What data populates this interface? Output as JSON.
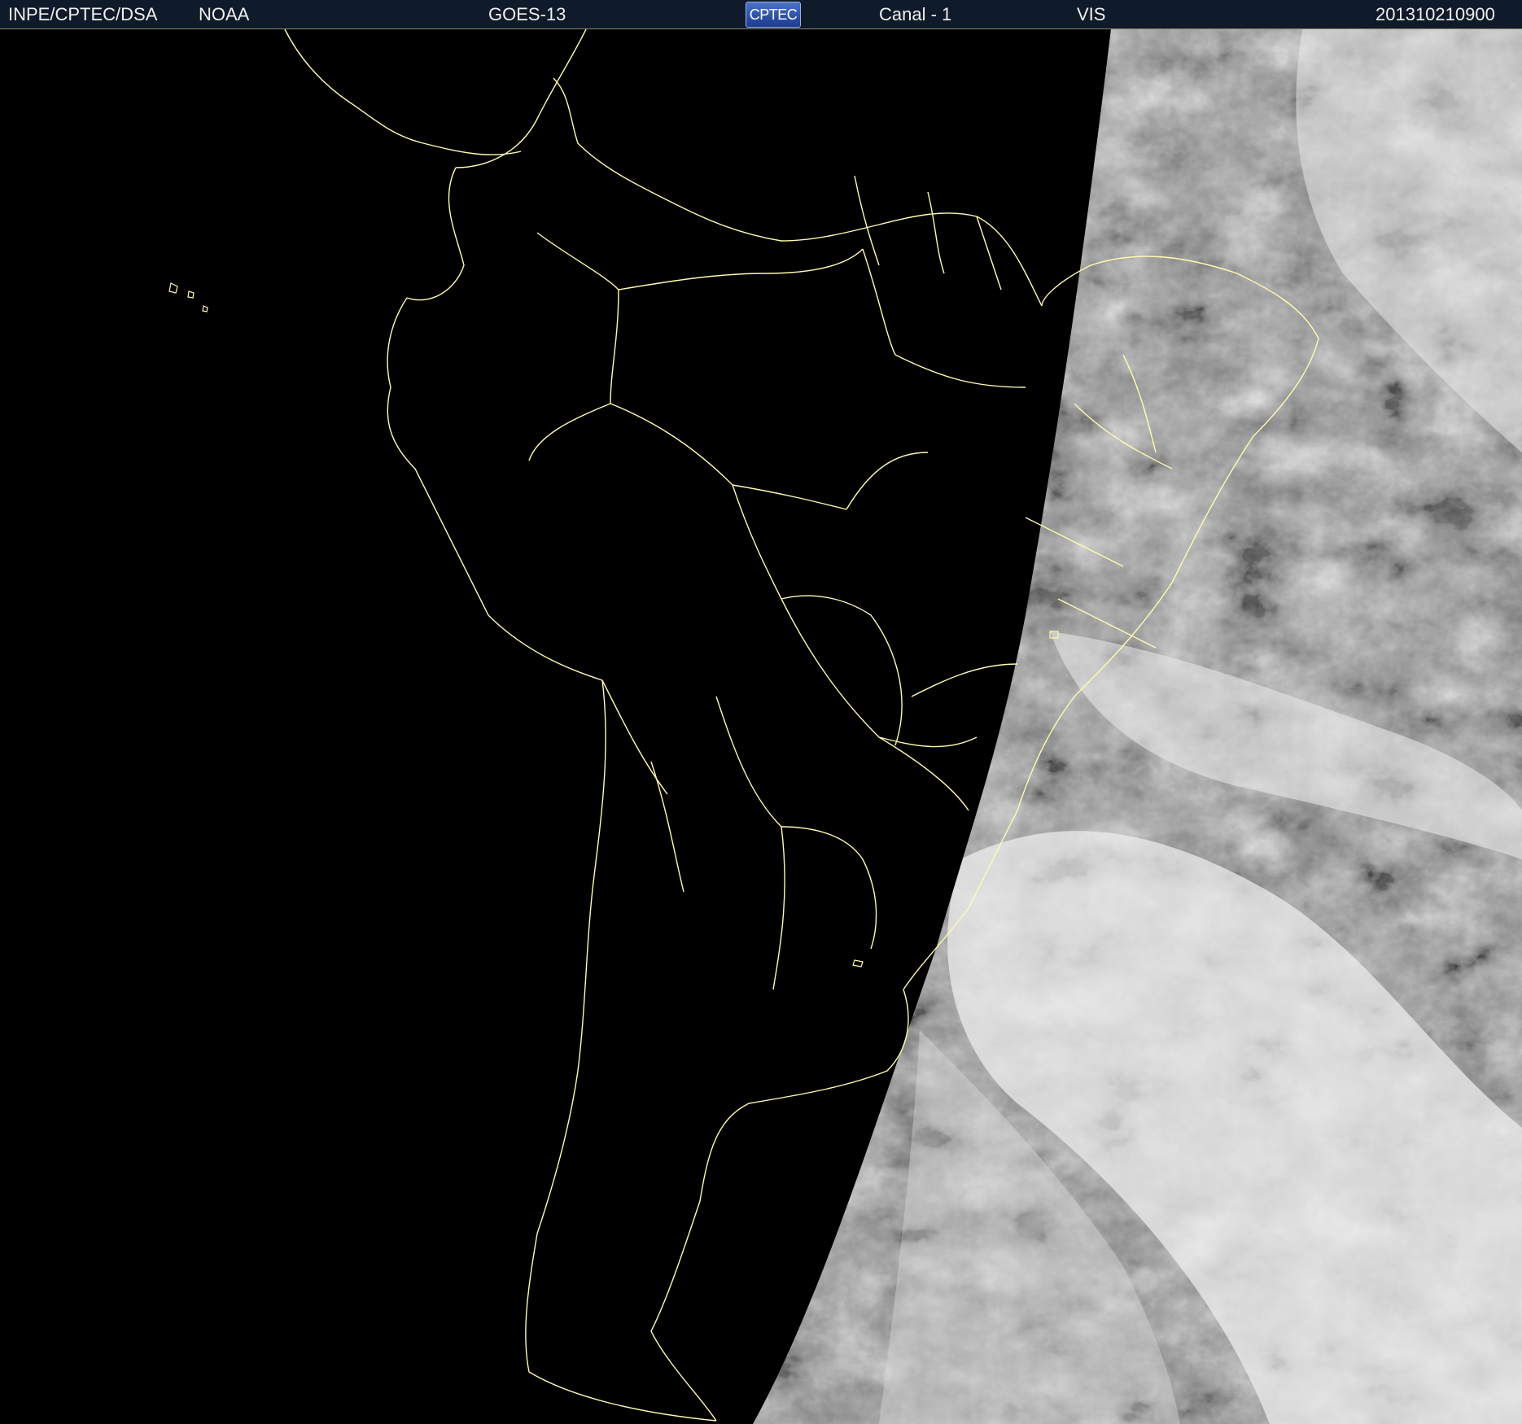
{
  "header": {
    "org": "INPE/CPTEC/DSA",
    "agency": "NOAA",
    "satellite": "GOES-13",
    "logo_text": "CPTEC",
    "channel": "Canal - 1",
    "band": "VIS",
    "timestamp": "201310210900"
  },
  "colors": {
    "header_bg": "#0f1a2a",
    "header_text": "#f0f0f0",
    "map_night": "#000000",
    "map_day": "#8c8c8c",
    "cloud": "#f2f2f2",
    "borders": "#fffbb0"
  }
}
